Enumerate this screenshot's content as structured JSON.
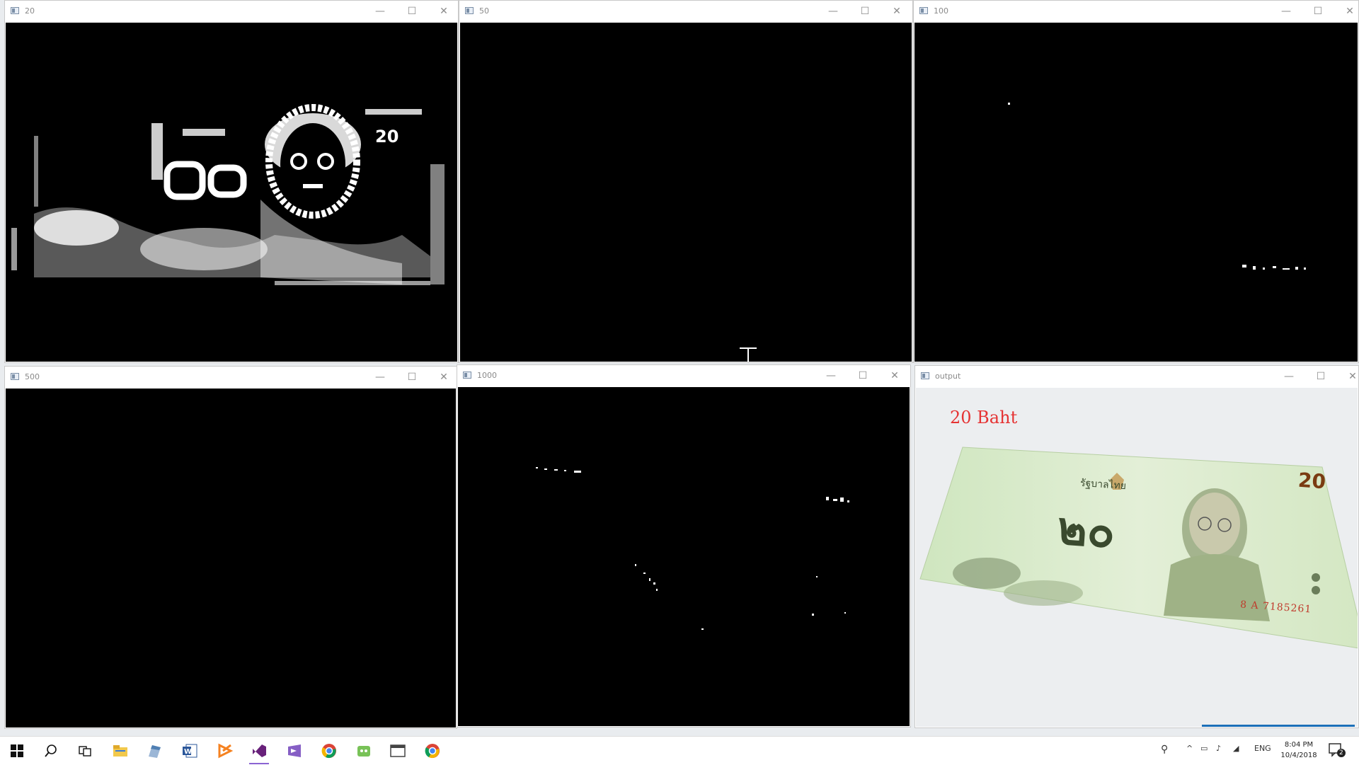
{
  "windows": [
    {
      "title": "20"
    },
    {
      "title": "50"
    },
    {
      "title": "100"
    },
    {
      "title": "500"
    },
    {
      "title": "1000"
    },
    {
      "title": "output"
    }
  ],
  "window_controls": {
    "minimize": "—",
    "maximize": "☐",
    "close": "✕"
  },
  "output": {
    "label": "20 Baht",
    "banknote": {
      "digits_large": "๒๐",
      "value": "20",
      "serial": "8 A 7185261",
      "thai_text": "รัฐบาลไทย"
    }
  },
  "taskbar": {
    "icons": [
      "windows-start-icon",
      "search-icon",
      "task-view-icon",
      "file-explorer-icon",
      "app-icon",
      "word-icon",
      "xampp-icon",
      "visual-studio-icon",
      "visual-studio-alt-icon",
      "chrome-icon",
      "android-studio-icon",
      "window-app-icon",
      "chrome-canary-icon"
    ],
    "language": "ENG",
    "time": "8:04 PM",
    "date": "10/4/2018",
    "notification_count": "2"
  },
  "colors": {
    "label_red": "#e53333",
    "accent": "#0078d7"
  }
}
